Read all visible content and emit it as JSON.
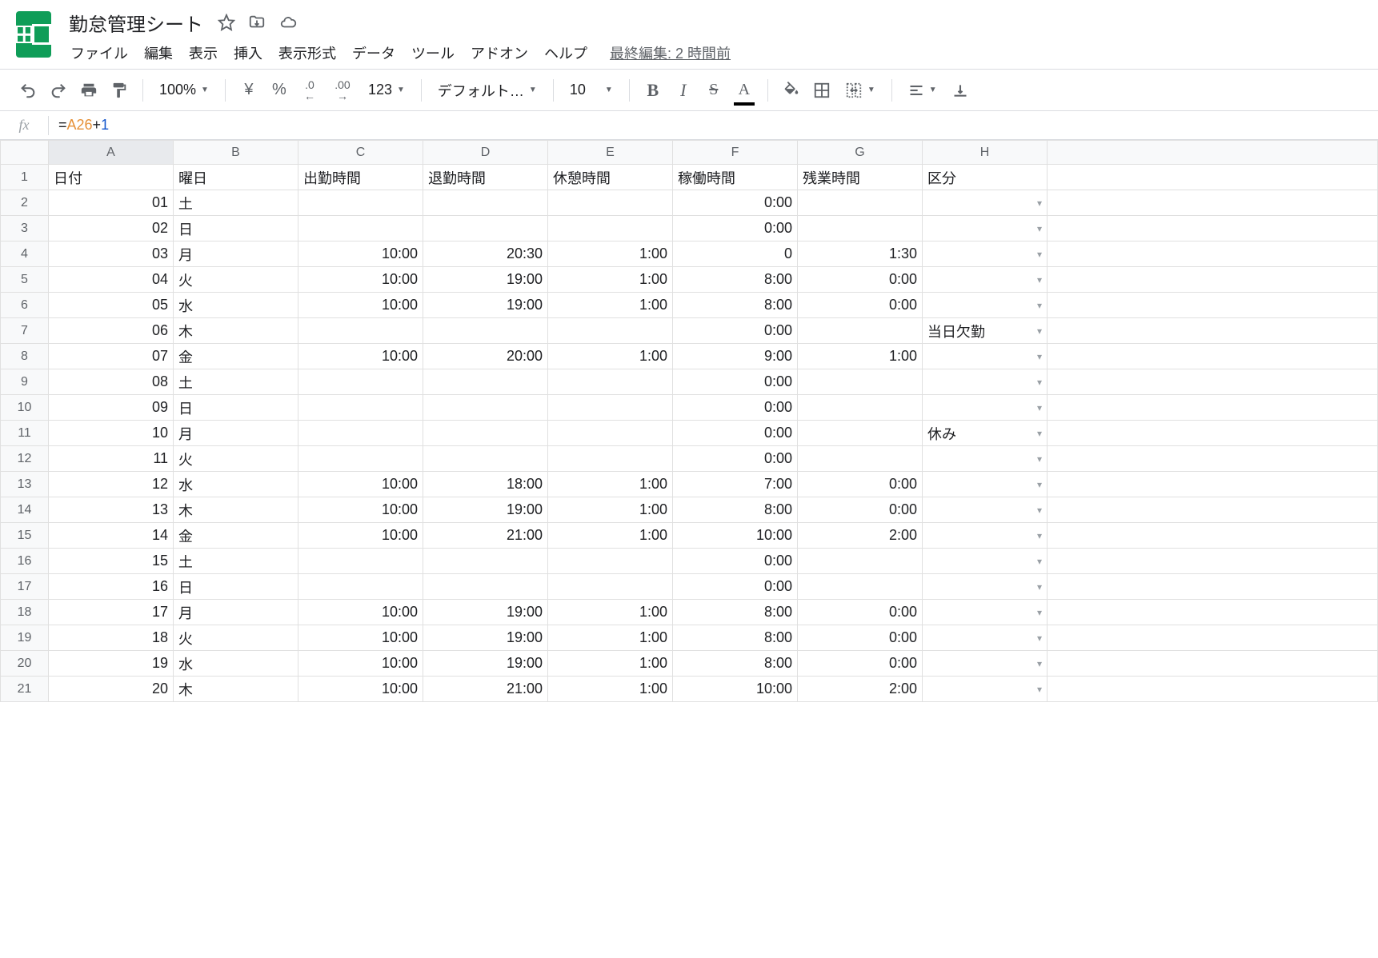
{
  "header": {
    "doc_title": "勤怠管理シート",
    "last_edit": "最終編集: 2 時間前"
  },
  "menubar": [
    "ファイル",
    "編集",
    "表示",
    "挿入",
    "表示形式",
    "データ",
    "ツール",
    "アドオン",
    "ヘルプ"
  ],
  "toolbar": {
    "zoom": "100%",
    "currency": "¥",
    "percent": "%",
    "dec_dec": ".0",
    "dec_inc": ".00",
    "more_formats": "123",
    "font": "デフォルト…",
    "font_size": "10"
  },
  "formula_bar": {
    "fx": "fx",
    "prefix": "=",
    "ref": "A26",
    "op": "+",
    "num": "1"
  },
  "grid": {
    "columns": [
      "A",
      "B",
      "C",
      "D",
      "E",
      "F",
      "G",
      "H"
    ],
    "selected_col": "A",
    "headers": [
      "日付",
      "曜日",
      "出勤時間",
      "退勤時間",
      "休憩時間",
      "稼働時間",
      "残業時間",
      "区分"
    ],
    "rows": [
      {
        "n": 1
      },
      {
        "n": 2,
        "A": "01",
        "B": "土",
        "C": "",
        "D": "",
        "E": "",
        "F": "0:00",
        "G": "",
        "H": ""
      },
      {
        "n": 3,
        "A": "02",
        "B": "日",
        "C": "",
        "D": "",
        "E": "",
        "F": "0:00",
        "G": "",
        "H": ""
      },
      {
        "n": 4,
        "A": "03",
        "B": "月",
        "C": "10:00",
        "D": "20:30",
        "E": "1:00",
        "F": "0",
        "G": "1:30",
        "H": ""
      },
      {
        "n": 5,
        "A": "04",
        "B": "火",
        "C": "10:00",
        "D": "19:00",
        "E": "1:00",
        "F": "8:00",
        "G": "0:00",
        "H": ""
      },
      {
        "n": 6,
        "A": "05",
        "B": "水",
        "C": "10:00",
        "D": "19:00",
        "E": "1:00",
        "F": "8:00",
        "G": "0:00",
        "H": ""
      },
      {
        "n": 7,
        "A": "06",
        "B": "木",
        "C": "",
        "D": "",
        "E": "",
        "F": "0:00",
        "G": "",
        "H": "当日欠勤"
      },
      {
        "n": 8,
        "A": "07",
        "B": "金",
        "C": "10:00",
        "D": "20:00",
        "E": "1:00",
        "F": "9:00",
        "G": "1:00",
        "H": ""
      },
      {
        "n": 9,
        "A": "08",
        "B": "土",
        "C": "",
        "D": "",
        "E": "",
        "F": "0:00",
        "G": "",
        "H": ""
      },
      {
        "n": 10,
        "A": "09",
        "B": "日",
        "C": "",
        "D": "",
        "E": "",
        "F": "0:00",
        "G": "",
        "H": ""
      },
      {
        "n": 11,
        "A": "10",
        "B": "月",
        "C": "",
        "D": "",
        "E": "",
        "F": "0:00",
        "G": "",
        "H": "休み"
      },
      {
        "n": 12,
        "A": "11",
        "B": "火",
        "C": "",
        "D": "",
        "E": "",
        "F": "0:00",
        "G": "",
        "H": ""
      },
      {
        "n": 13,
        "A": "12",
        "B": "水",
        "C": "10:00",
        "D": "18:00",
        "E": "1:00",
        "F": "7:00",
        "G": "0:00",
        "H": ""
      },
      {
        "n": 14,
        "A": "13",
        "B": "木",
        "C": "10:00",
        "D": "19:00",
        "E": "1:00",
        "F": "8:00",
        "G": "0:00",
        "H": ""
      },
      {
        "n": 15,
        "A": "14",
        "B": "金",
        "C": "10:00",
        "D": "21:00",
        "E": "1:00",
        "F": "10:00",
        "G": "2:00",
        "H": ""
      },
      {
        "n": 16,
        "A": "15",
        "B": "土",
        "C": "",
        "D": "",
        "E": "",
        "F": "0:00",
        "G": "",
        "H": ""
      },
      {
        "n": 17,
        "A": "16",
        "B": "日",
        "C": "",
        "D": "",
        "E": "",
        "F": "0:00",
        "G": "",
        "H": ""
      },
      {
        "n": 18,
        "A": "17",
        "B": "月",
        "C": "10:00",
        "D": "19:00",
        "E": "1:00",
        "F": "8:00",
        "G": "0:00",
        "H": ""
      },
      {
        "n": 19,
        "A": "18",
        "B": "火",
        "C": "10:00",
        "D": "19:00",
        "E": "1:00",
        "F": "8:00",
        "G": "0:00",
        "H": ""
      },
      {
        "n": 20,
        "A": "19",
        "B": "水",
        "C": "10:00",
        "D": "19:00",
        "E": "1:00",
        "F": "8:00",
        "G": "0:00",
        "H": ""
      },
      {
        "n": 21,
        "A": "20",
        "B": "木",
        "C": "10:00",
        "D": "21:00",
        "E": "1:00",
        "F": "10:00",
        "G": "2:00",
        "H": ""
      }
    ]
  }
}
